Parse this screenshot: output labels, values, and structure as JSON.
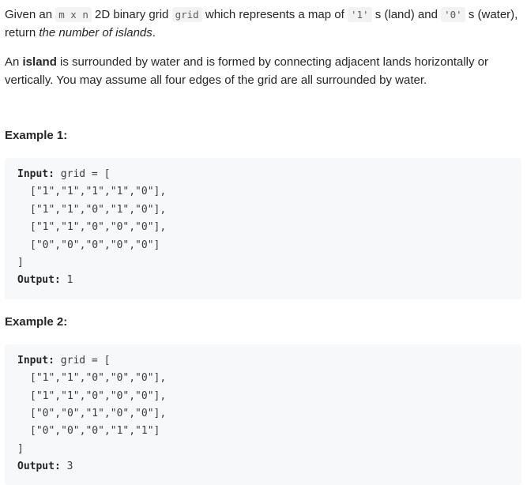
{
  "intro": {
    "p1_a": "Given an ",
    "p1_code_mxn": "m x n",
    "p1_b": " 2D binary grid ",
    "p1_code_grid": "grid",
    "p1_c": " which represents a map of ",
    "p1_code_one": "'1'",
    "p1_d": " s (land) and ",
    "p1_code_zero": "'0'",
    "p1_e": " s (water), return ",
    "p1_em": "the number of islands",
    "p1_f": ".",
    "p2_a": "An ",
    "p2_strong": "island",
    "p2_b": " is surrounded by water and is formed by connecting adjacent lands horizontally or vertically. You may assume all four edges of the grid are all surrounded by water."
  },
  "examples": [
    {
      "title": "Example 1:",
      "input_label": "Input:",
      "input_head": "grid = [",
      "rows": [
        "[\"1\",\"1\",\"1\",\"1\",\"0\"],",
        "[\"1\",\"1\",\"0\",\"1\",\"0\"],",
        "[\"1\",\"1\",\"0\",\"0\",\"0\"],",
        "[\"0\",\"0\",\"0\",\"0\",\"0\"]"
      ],
      "close": "]",
      "output_label": "Output:",
      "output_value": "1"
    },
    {
      "title": "Example 2:",
      "input_label": "Input:",
      "input_head": "grid = [",
      "rows": [
        "[\"1\",\"1\",\"0\",\"0\",\"0\"],",
        "[\"1\",\"1\",\"0\",\"0\",\"0\"],",
        "[\"0\",\"0\",\"1\",\"0\",\"0\"],",
        "[\"0\",\"0\",\"0\",\"1\",\"1\"]"
      ],
      "close": "]",
      "output_label": "Output:",
      "output_value": "3"
    }
  ]
}
